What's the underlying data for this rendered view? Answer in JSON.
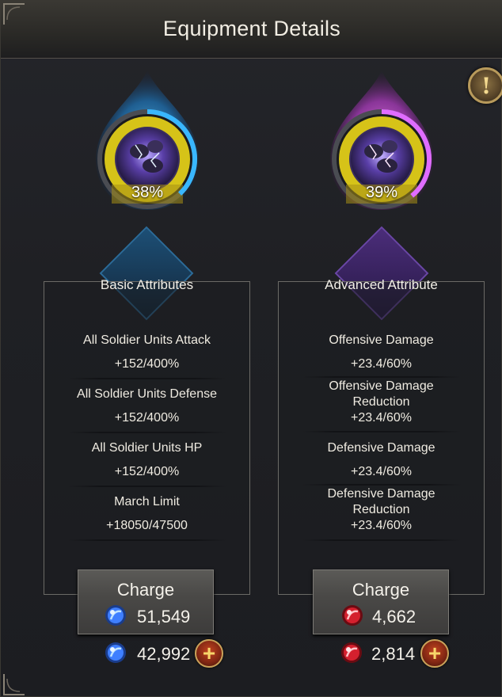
{
  "header": {
    "title": "Equipment Details"
  },
  "info_button": {
    "symbol": "!"
  },
  "left": {
    "progress_percent_label": "38%",
    "progress_fraction": 0.38,
    "accent": "#39b7ff",
    "panel_title": "Basic Attributes",
    "attributes": [
      {
        "name": "All Soldier Units Attack",
        "value": "+152/400%"
      },
      {
        "name": "All Soldier Units Defense",
        "value": "+152/400%"
      },
      {
        "name": "All Soldier Units HP",
        "value": "+152/400%"
      },
      {
        "name": "March Limit",
        "value": "+18050/47500"
      }
    ],
    "charge": {
      "label": "Charge",
      "cost": "51,549",
      "orb": "blue-orb-icon"
    },
    "owned": {
      "amount": "42,992",
      "orb": "blue-orb-icon"
    }
  },
  "right": {
    "progress_percent_label": "39%",
    "progress_fraction": 0.39,
    "accent": "#e06cff",
    "panel_title": "Advanced Attribute",
    "attributes": [
      {
        "name": "Offensive Damage",
        "value": "+23.4/60%"
      },
      {
        "name_line1": "Offensive Damage",
        "name_line2": "Reduction",
        "value": "+23.4/60%"
      },
      {
        "name": "Defensive Damage",
        "value": "+23.4/60%"
      },
      {
        "name_line1": "Defensive Damage",
        "name_line2": "Reduction",
        "value": "+23.4/60%"
      }
    ],
    "charge": {
      "label": "Charge",
      "cost": "4,662",
      "orb": "red-orb-icon"
    },
    "owned": {
      "amount": "2,814",
      "orb": "red-orb-icon"
    }
  }
}
